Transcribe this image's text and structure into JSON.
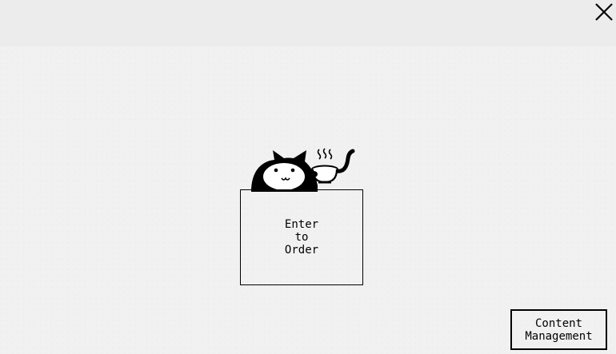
{
  "buttons": {
    "enter_label": "Enter to Order",
    "content_management_label": "Content Management"
  },
  "icons": {
    "close": "close-icon",
    "mascot": "cat-with-bowl-icon"
  },
  "colors": {
    "background": "#f1f1f1",
    "ink": "#000000"
  }
}
